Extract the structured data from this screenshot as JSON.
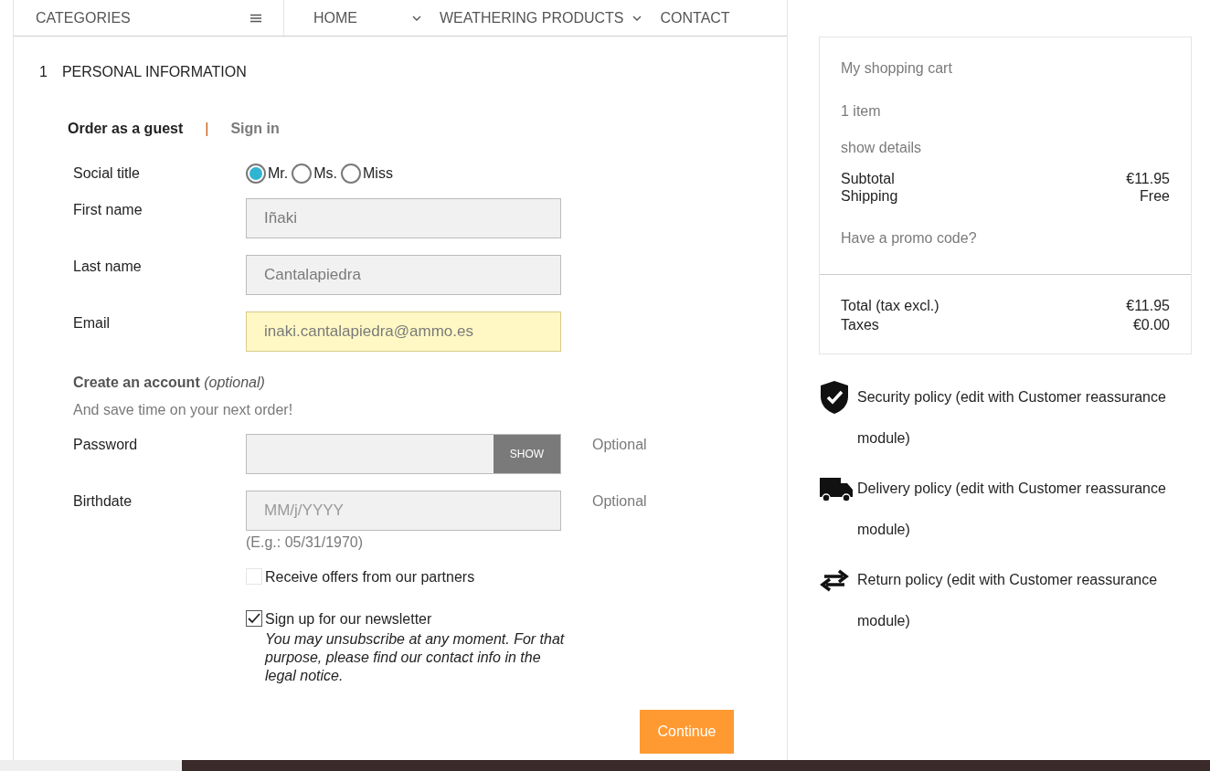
{
  "nav": {
    "categories": "CATEGORIES",
    "items": [
      {
        "label": "HOME",
        "dropdown": true
      },
      {
        "label": "WEATHERING PRODUCTS",
        "dropdown": true
      },
      {
        "label": "CONTACT",
        "dropdown": false
      }
    ]
  },
  "step": {
    "number": "1",
    "title": "PERSONAL INFORMATION"
  },
  "auth_tabs": [
    {
      "label": "Order as a guest",
      "selected": true
    },
    {
      "label": "Sign in",
      "selected": false
    }
  ],
  "auth_separator": "|",
  "social_title": {
    "label": "Social title",
    "options": [
      {
        "label": "Mr.",
        "selected": true
      },
      {
        "label": "Ms.",
        "selected": false
      },
      {
        "label": "Miss",
        "selected": false
      }
    ]
  },
  "fields": [
    {
      "label": "First name",
      "value": "Iñaki",
      "autofilled": false
    },
    {
      "label": "Last name",
      "value": "Cantalapiedra",
      "autofilled": false
    },
    {
      "label": "Email",
      "value": "inaki.cantalapiedra@ammo.es",
      "autofilled": true
    }
  ],
  "create_account": {
    "title": "Create an account",
    "optional": "(optional)",
    "subtitle": "And save time on your next order!"
  },
  "password": {
    "label": "Password",
    "button": "SHOW",
    "note": "Optional"
  },
  "birthdate": {
    "label": "Birthdate",
    "placeholder": "MM/j/YYYY",
    "hint": "(E.g.: 05/31/1970)",
    "note": "Optional"
  },
  "checkboxes": [
    {
      "label": "Receive offers from our partners",
      "checked": false
    },
    {
      "label": "Sign up for our newsletter",
      "checked": true,
      "note": "You may unsubscribe at any moment. For that purpose, please find our contact info in the legal notice."
    }
  ],
  "continue_button": "Continue",
  "cart": {
    "title": "My shopping cart",
    "count": "1 item",
    "details": "show details",
    "lines": [
      {
        "label": "Subtotal",
        "value": "€11.95"
      },
      {
        "label": "Shipping",
        "value": "Free"
      }
    ],
    "promo": "Have a promo code?",
    "totals": [
      {
        "label": "Total (tax excl.)",
        "value": "€11.95"
      },
      {
        "label": "Taxes",
        "value": "€0.00"
      }
    ]
  },
  "policies": [
    {
      "kind": "security",
      "text": "Security policy (edit with Customer reassurance module)"
    },
    {
      "kind": "delivery",
      "text": "Delivery policy (edit with Customer reassurance module)"
    },
    {
      "kind": "return",
      "text": "Return policy (edit with Customer reassurance module)"
    }
  ]
}
